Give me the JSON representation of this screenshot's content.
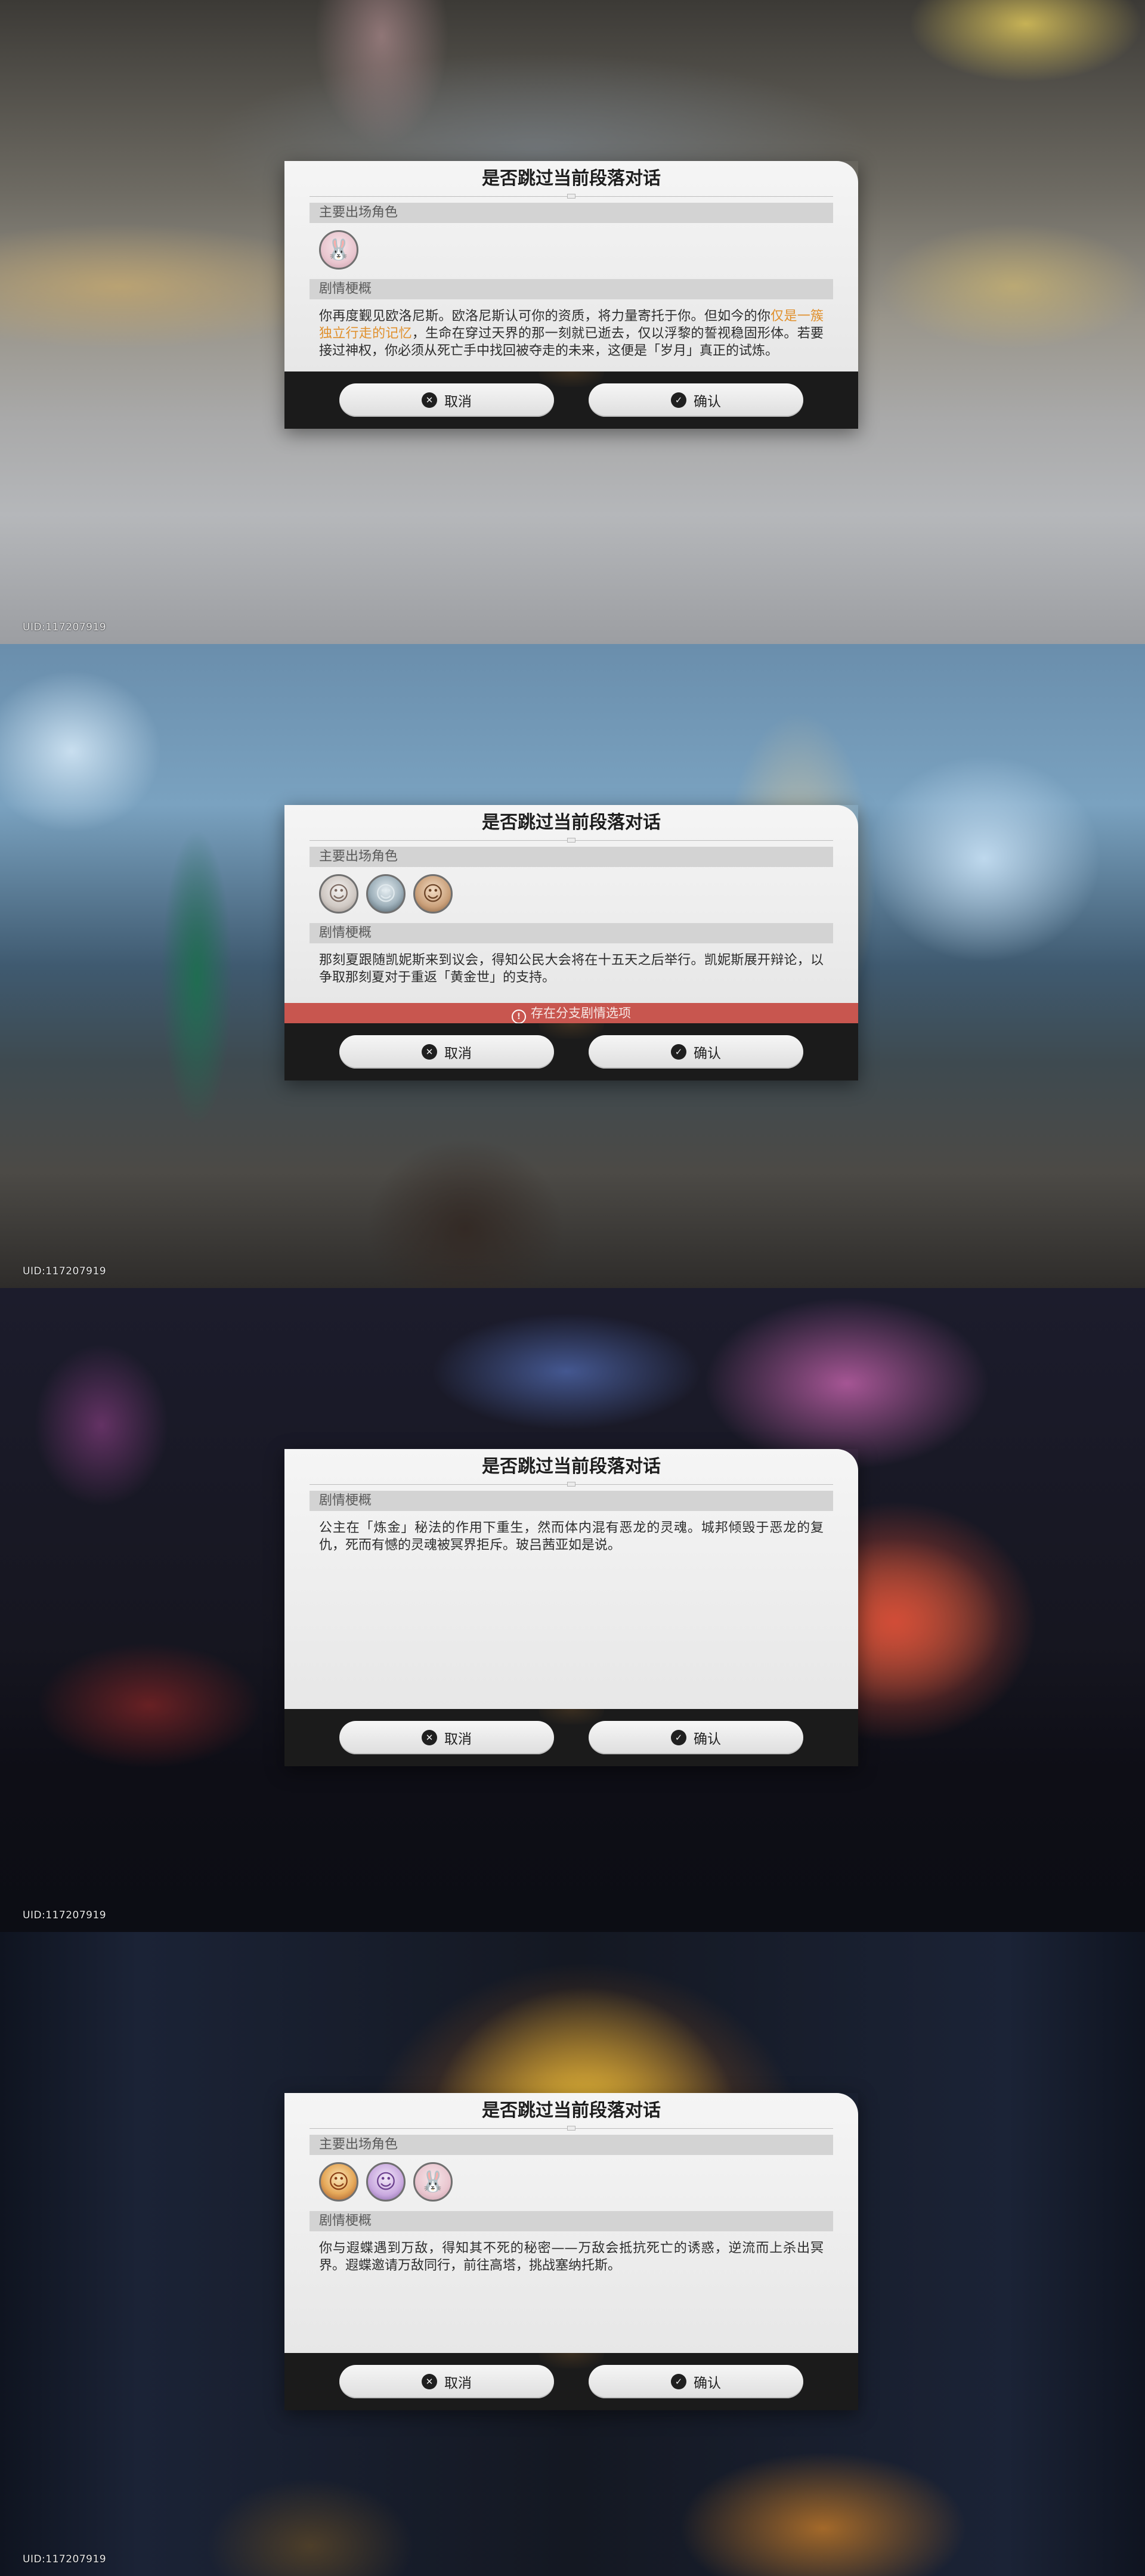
{
  "uid_text": "UID:117207919",
  "dialog_title": "是否跳过当前段落对话",
  "section_characters": "主要出场角色",
  "section_synopsis": "剧情梗概",
  "cancel_label": "取消",
  "confirm_label": "确认",
  "panels": [
    {
      "avatars": [
        {
          "icon": "rabbit-icon",
          "glyph": "🐰"
        }
      ],
      "synopsis_part1": "你再度觐见欧洛尼斯。欧洛尼斯认可你的资质，将力量寄托于你。但如今的你",
      "synopsis_highlight": "仅是一簇独立行走的记忆",
      "synopsis_part2": "，生命在穿过天界的那一刻就已逝去，仅以浮黎的誓视稳固形体。若要接过神权，你必须从死亡手中找回被夺走的未来，这便是「岁月」真正的试炼。"
    },
    {
      "avatars": [
        {
          "icon": "white-hair-character-icon",
          "glyph": "☺"
        },
        {
          "icon": "silver-hair-character-icon",
          "glyph": "☺"
        },
        {
          "icon": "brown-hair-character-icon",
          "glyph": "☺"
        }
      ],
      "synopsis": "那刻夏跟随凯妮斯来到议会，得知公民大会将在十五天之后举行。凯妮斯展开辩论，以争取那刻夏对于重返「黄金世」的支持。",
      "branch_notice": "存在分支剧情选项"
    },
    {
      "synopsis": "公主在「炼金」秘法的作用下重生，然而体内混有恶龙的灵魂。城邦倾毁于恶龙的复仇，死而有憾的灵魂被冥界拒斥。玻吕茜亚如是说。"
    },
    {
      "avatars": [
        {
          "icon": "golden-hair-character-icon",
          "glyph": "☺"
        },
        {
          "icon": "purple-hair-character-icon",
          "glyph": "☺"
        },
        {
          "icon": "rabbit-icon",
          "glyph": "🐰"
        }
      ],
      "synopsis": "你与遐蝶遇到万敌，得知其不死的秘密——万敌会抵抗死亡的诱惑，逆流而上杀出冥界。遐蝶邀请万敌同行，前往高塔，挑战塞纳托斯。"
    }
  ],
  "colors": {
    "highlight": "#e0902d",
    "banner": "#c8564f",
    "footer": "#1b1b1b"
  }
}
